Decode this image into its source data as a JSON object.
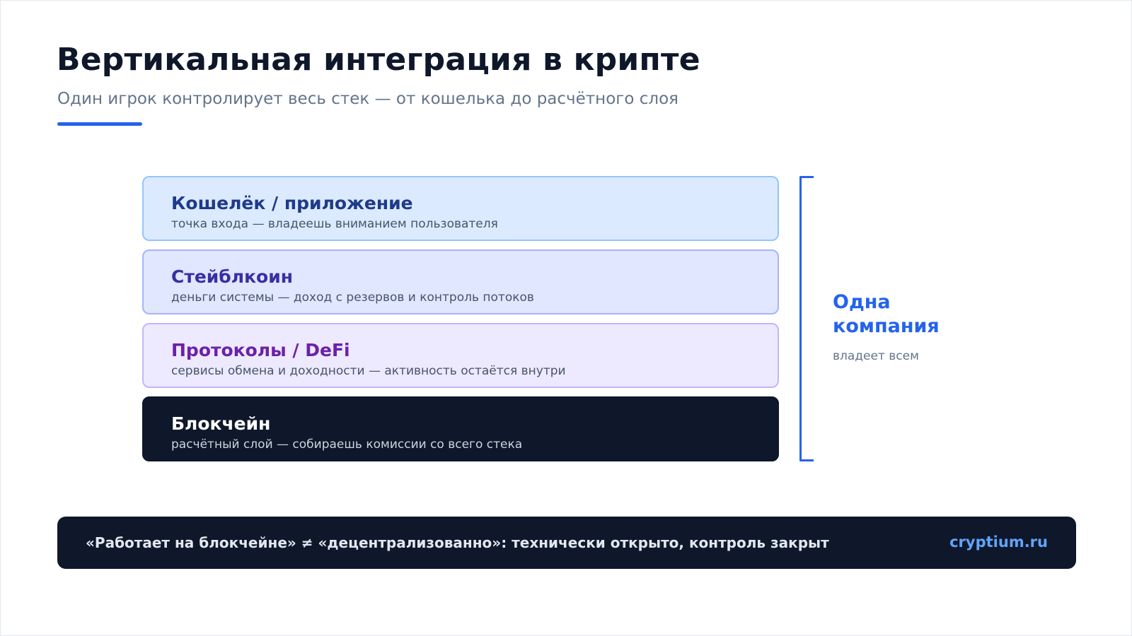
{
  "header": {
    "title": "Вертикальная интеграция в крипте",
    "subtitle": "Один игрок контролирует весь стек — от кошелька до расчётного слоя"
  },
  "stack": {
    "layers": [
      {
        "title": "Кошелёк / приложение",
        "description": "точка входа — владеешь вниманием пользователя",
        "bg": "#dbeafe",
        "border": "#93c5fd",
        "title_color": "#1e3a8a"
      },
      {
        "title": "Стейблкоин",
        "description": "деньги системы — доход с резервов и контроль потоков",
        "bg": "#e0e7ff",
        "border": "#a5b4fc",
        "title_color": "#3730a3"
      },
      {
        "title": "Протоколы / DeFi",
        "description": "сервисы обмена и доходности — активность остаётся внутри",
        "bg": "#ede9fe",
        "border": "#c4b5fd",
        "title_color": "#6b21a8"
      },
      {
        "title": "Блокчейн",
        "description": "расчётный слой — собираешь комиссии со всего стека",
        "bg": "#0f172a",
        "border": "#0f172a",
        "title_color": "#ffffff",
        "desc_color": "#cbd5e1"
      }
    ]
  },
  "company": {
    "title": "Одна компания",
    "subtitle": "владеет всем"
  },
  "footer": {
    "text": "«Работает на блокчейне» ≠ «децентрализованно»: технически открыто, контроль закрыт",
    "brand": "cryptium.ru"
  },
  "colors": {
    "accent": "#2563eb",
    "dark": "#0f172a"
  }
}
